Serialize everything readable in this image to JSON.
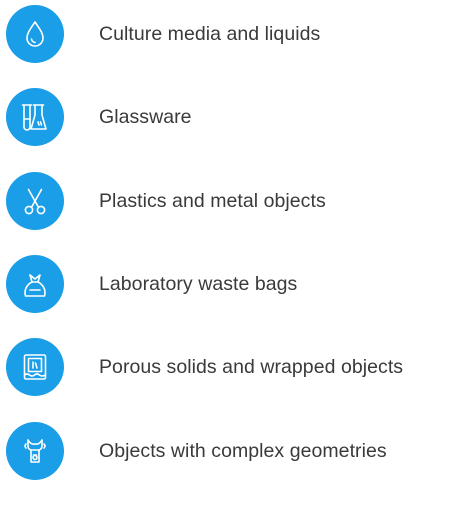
{
  "accent_color": "#1a9ee8",
  "items": [
    {
      "label": "Culture media and liquids",
      "icon": "droplet-icon"
    },
    {
      "label": "Glassware",
      "icon": "flask-icon"
    },
    {
      "label": "Plastics and metal objects",
      "icon": "scissors-icon"
    },
    {
      "label": "Laboratory waste bags",
      "icon": "waste-bag-icon"
    },
    {
      "label": "Porous solids and wrapped objects",
      "icon": "wrapped-package-icon"
    },
    {
      "label": "Objects with complex geometries",
      "icon": "complex-object-icon"
    }
  ]
}
